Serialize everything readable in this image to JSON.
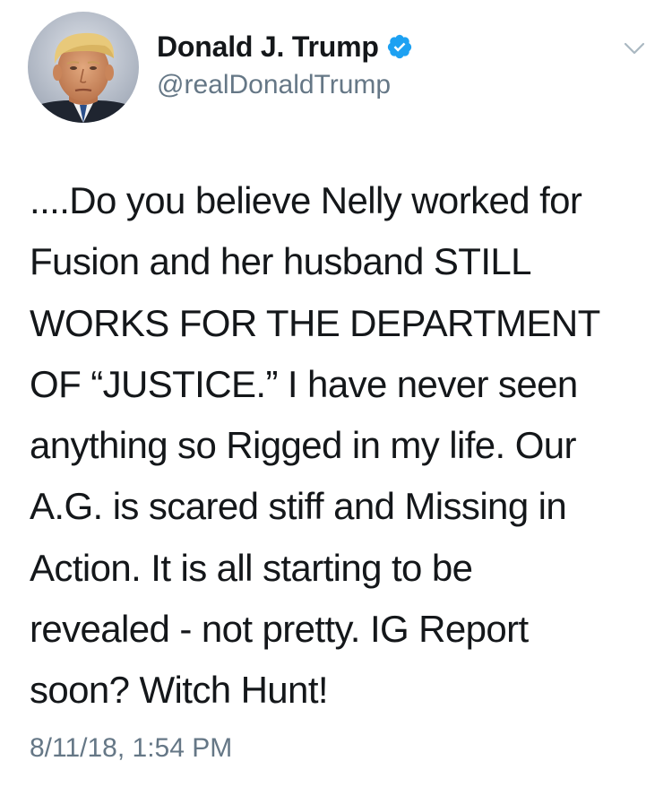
{
  "tweet": {
    "author": {
      "display_name": "Donald J. Trump",
      "handle": "@realDonaldTrump",
      "verified": true,
      "avatar_icon": "profile-photo",
      "verified_icon": "verified-badge-icon",
      "verified_color": "#1da1f2"
    },
    "menu_icon": "chevron-down-icon",
    "text": "....Do you believe Nelly worked for\nFusion and her husband STILL\nWORKS FOR THE DEPARTMENT\nOF “JUSTICE.” I have never seen\nanything so Rigged in my life. Our\nA.G. is scared stiff and Missing in\nAction. It is all starting to be\nrevealed - not pretty. IG Report\nsoon?  Witch Hunt!",
    "timestamp": "8/11/18, 1:54 PM"
  },
  "colors": {
    "text_primary": "#14171a",
    "text_secondary": "#657786",
    "background": "#ffffff"
  }
}
